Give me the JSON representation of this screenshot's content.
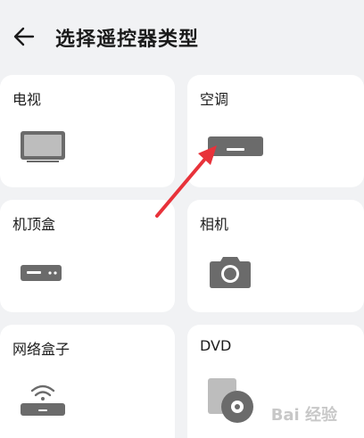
{
  "header": {
    "title": "选择遥控器类型",
    "back_icon": "arrow-left-icon"
  },
  "device_types": [
    {
      "label": "电视",
      "icon": "tv-icon"
    },
    {
      "label": "空调",
      "icon": "air-conditioner-icon"
    },
    {
      "label": "机顶盒",
      "icon": "set-top-box-icon"
    },
    {
      "label": "相机",
      "icon": "camera-icon"
    },
    {
      "label": "网络盒子",
      "icon": "network-box-icon"
    },
    {
      "label": "DVD",
      "icon": "dvd-icon"
    }
  ],
  "colors": {
    "background": "#f1f2f4",
    "card": "#ffffff",
    "icon_gray": "#6b6b6b",
    "annotation_red": "#e8323a"
  },
  "watermark": "Bai 经验"
}
